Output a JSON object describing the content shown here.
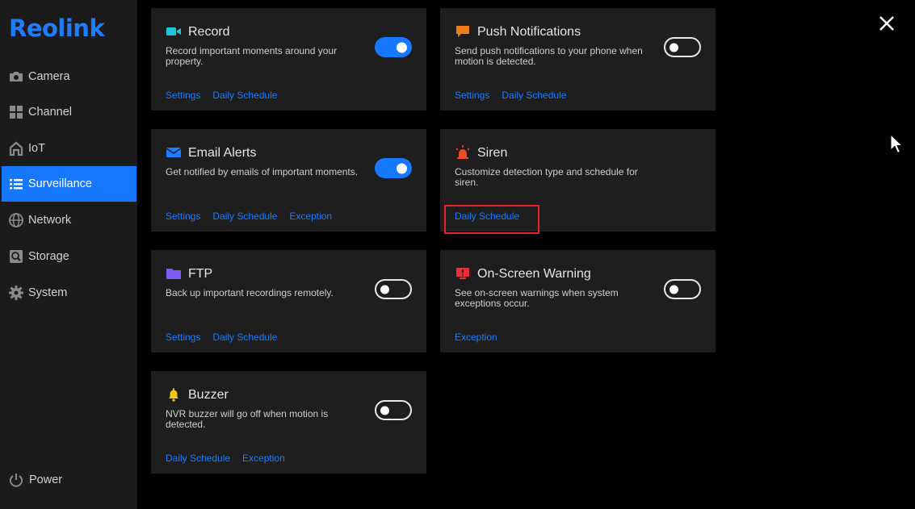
{
  "app": {
    "logo_text": "Reolink"
  },
  "sidebar": {
    "items": [
      {
        "label": "Camera",
        "icon": "camera-icon",
        "active": false
      },
      {
        "label": "Channel",
        "icon": "channel-grid-icon",
        "active": false
      },
      {
        "label": "IoT",
        "icon": "home-icon",
        "active": false
      },
      {
        "label": "Surveillance",
        "icon": "list-icon",
        "active": true
      },
      {
        "label": "Network",
        "icon": "globe-icon",
        "active": false
      },
      {
        "label": "Storage",
        "icon": "storage-icon",
        "active": false
      },
      {
        "label": "System",
        "icon": "gear-icon",
        "active": false
      }
    ],
    "power_label": "Power"
  },
  "cards": {
    "record": {
      "title": "Record",
      "desc": "Record important moments around your property.",
      "toggle_on": true,
      "links": [
        "Settings",
        "Daily Schedule"
      ],
      "icon_color": "#1fc6d6"
    },
    "push": {
      "title": "Push Notifications",
      "desc": "Send push notifications to your phone when motion is detected.",
      "toggle_on": false,
      "links": [
        "Settings",
        "Daily Schedule"
      ],
      "icon_color": "#f07d19"
    },
    "email": {
      "title": "Email Alerts",
      "desc": "Get notified by emails of important moments.",
      "toggle_on": true,
      "links": [
        "Settings",
        "Daily Schedule",
        "Exception"
      ],
      "icon_color": "#1e7cff"
    },
    "siren": {
      "title": "Siren",
      "desc": "Customize detection type and schedule for siren.",
      "links": [
        "Daily Schedule"
      ],
      "icon_color": "#f04a24"
    },
    "ftp": {
      "title": "FTP",
      "desc": "Back up important recordings remotely.",
      "toggle_on": false,
      "links": [
        "Settings",
        "Daily Schedule"
      ],
      "icon_color": "#7b5cf5"
    },
    "onscreen": {
      "title": "On-Screen Warning",
      "desc": "See on-screen warnings when system exceptions occur.",
      "toggle_on": false,
      "links": [
        "Exception"
      ],
      "icon_color": "#e8303a"
    },
    "buzzer": {
      "title": "Buzzer",
      "desc": "NVR buzzer will go off when motion is detected.",
      "toggle_on": false,
      "links": [
        "Daily Schedule",
        "Exception"
      ],
      "icon_color": "#f5c518"
    }
  },
  "colors": {
    "accent": "#1677ff",
    "highlight": "#e8242a"
  }
}
